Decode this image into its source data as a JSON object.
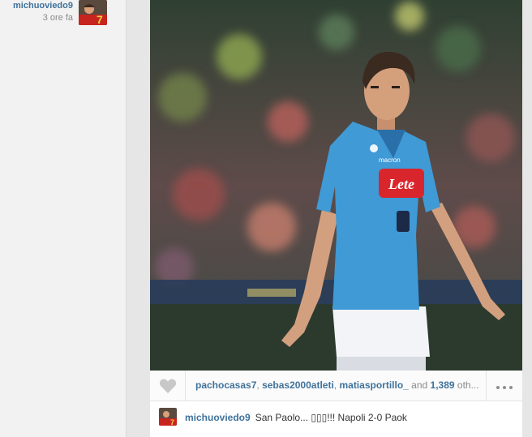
{
  "post": {
    "username": "michuoviedo9",
    "time": "3 ore fa"
  },
  "likes": {
    "users": [
      "pachocasas7",
      "sebas2000atleti",
      "matiasportillo_"
    ],
    "separator": ", ",
    "and_text": " and ",
    "count": "1,389",
    "suffix": " oth..."
  },
  "caption": {
    "username": "michuoviedo9",
    "text": "San Paolo... ▯▯▯!!! Napoli 2-0 Paok"
  },
  "photo": {
    "shirt_sponsor": "Lete",
    "kit_brand": "macron"
  },
  "colors": {
    "link": "#3f729b",
    "shirt": "#3f9ad6",
    "sponsor": "#d9262c"
  },
  "icons": {
    "like": "heart-icon",
    "more": "ellipsis-icon"
  }
}
